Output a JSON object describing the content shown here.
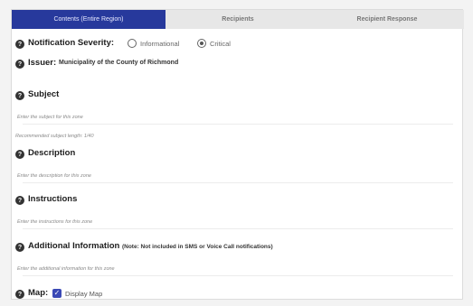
{
  "tabs": [
    {
      "label": "Contents (Entire Region)"
    },
    {
      "label": "Recipients"
    },
    {
      "label": "Recipient Response"
    }
  ],
  "severity": {
    "label": "Notification Severity:",
    "options": [
      "Informational",
      "Critical"
    ],
    "selected": "Critical"
  },
  "issuer": {
    "label": "Issuer:",
    "value": "Municipality of the County of Richmond"
  },
  "subject": {
    "label": "Subject",
    "placeholder": "Enter the subject for this zone",
    "length_hint": "Recommended subject length: 1/40"
  },
  "description": {
    "label": "Description",
    "placeholder": "Enter the description for this zone"
  },
  "instructions": {
    "label": "Instructions",
    "placeholder": "Enter the instructions for this zone"
  },
  "additional": {
    "label": "Additional Information",
    "note": "(Note: Not included in SMS or Voice Call notifications)",
    "placeholder": "Enter the additional information for this zone"
  },
  "map": {
    "label": "Map:",
    "checkbox_label": "Display Map",
    "checked": true
  },
  "help_glyph": "?",
  "check_glyph": "✓",
  "colors": {
    "active_tab": "#27399c",
    "checkbox": "#3a49b5"
  }
}
